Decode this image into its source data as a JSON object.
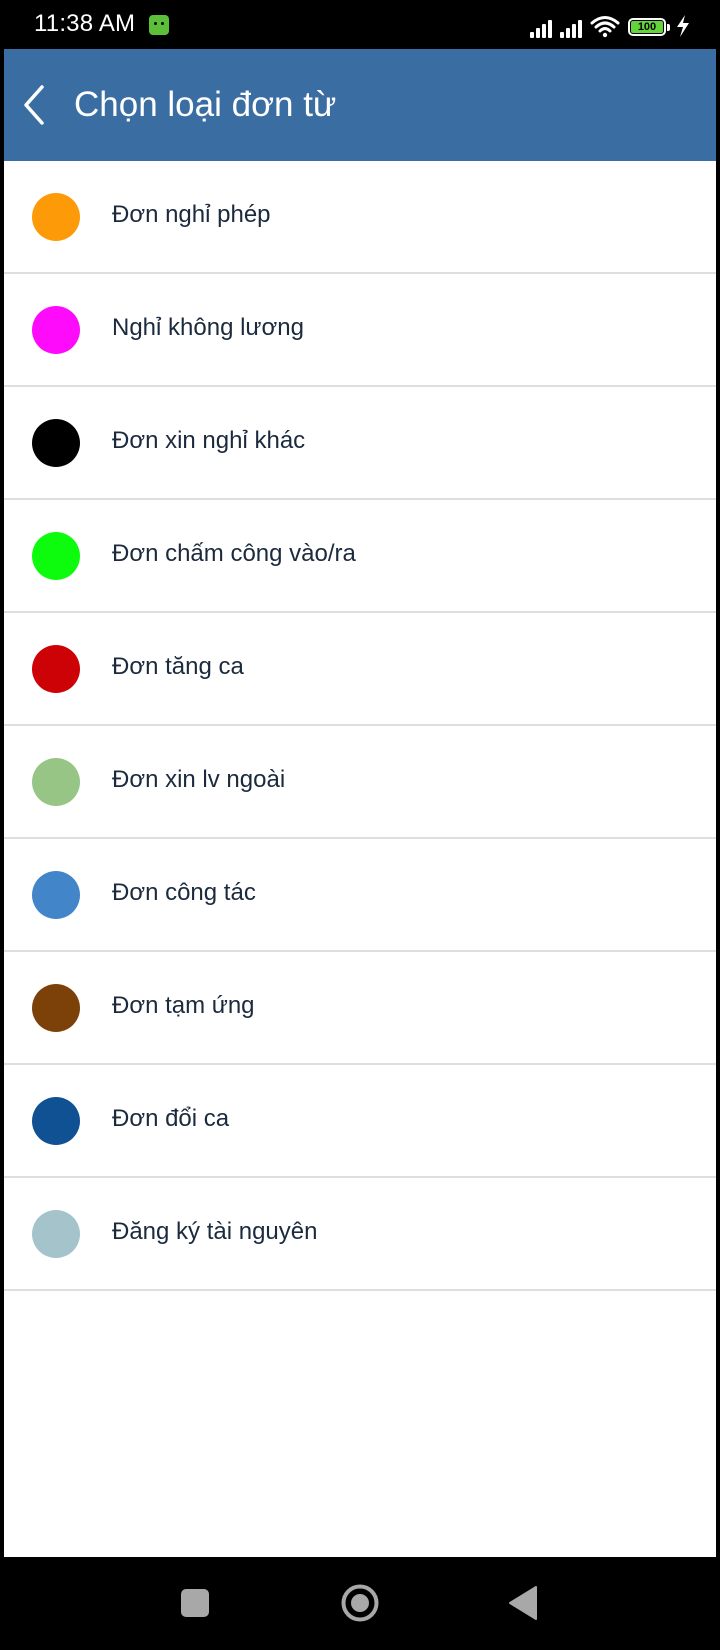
{
  "status_bar": {
    "time": "11:38 AM",
    "battery": "100"
  },
  "header": {
    "title": "Chọn loại đơn từ",
    "back_icon": "chevron-left-icon"
  },
  "items": [
    {
      "label": "Đơn nghỉ phép",
      "color": "#fd9a08"
    },
    {
      "label": "Nghỉ không lương",
      "color": "#fe0bfb"
    },
    {
      "label": "Đơn xin nghỉ khác",
      "color": "#000000"
    },
    {
      "label": "Đơn chấm công vào/ra",
      "color": "#0dfb0d"
    },
    {
      "label": "Đơn tăng ca",
      "color": "#cc0206"
    },
    {
      "label": "Đơn xin lv ngoài",
      "color": "#96c586"
    },
    {
      "label": "Đơn công tác",
      "color": "#4385c9"
    },
    {
      "label": "Đơn tạm ứng",
      "color": "#7c4108"
    },
    {
      "label": "Đơn đổi ca",
      "color": "#0f5193"
    },
    {
      "label": "Đăng ký tài nguyên",
      "color": "#a4c3cb"
    }
  ],
  "colors": {
    "app_bar": "#3a6ea3",
    "divider": "#dedede"
  }
}
